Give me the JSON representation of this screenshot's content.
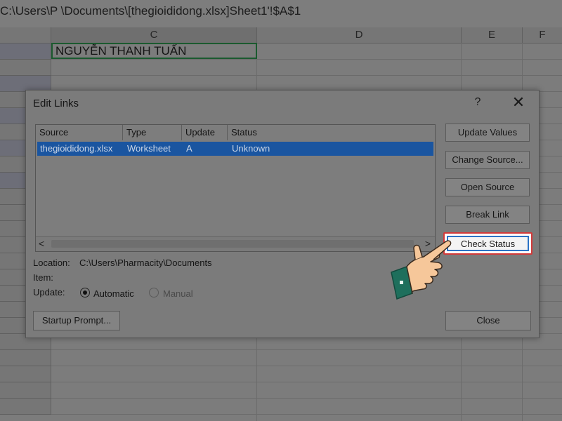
{
  "formula_bar": {
    "text": "C:\\Users\\P           \\Documents\\[thegioididong.xlsx]Sheet1'!$A$1"
  },
  "sheet": {
    "columns": [
      {
        "label": "C",
        "selected": true
      },
      {
        "label": "D",
        "selected": false
      },
      {
        "label": "E",
        "selected": false
      },
      {
        "label": "F",
        "selected": false
      }
    ],
    "active_cell_value": "NGUYỄN THANH TUẤN"
  },
  "dialog": {
    "title": "Edit Links",
    "help": "?",
    "close": "✕",
    "list": {
      "headers": [
        "Source",
        "Type",
        "Update",
        "Status"
      ],
      "rows": [
        {
          "source": "thegioididong.xlsx",
          "type": "Worksheet",
          "update": "A",
          "status": "Unknown"
        }
      ],
      "scroll_left": "<",
      "scroll_right": ">"
    },
    "location_label": "Location:",
    "location_value": "C:\\Users\\Pharmacity\\Documents",
    "item_label": "Item:",
    "update_label": "Update:",
    "automatic_label": "Automatic",
    "manual_label": "Manual",
    "update_mode": "Automatic",
    "buttons": {
      "update_values": "Update Values",
      "change_source": "Change Source...",
      "open_source": "Open Source",
      "break_link": "Break Link",
      "check_status": "Check Status",
      "startup_prompt": "Startup Prompt...",
      "close": "Close"
    }
  },
  "colors": {
    "highlight_border": "#d23a3a",
    "selection": "#1a55a0",
    "skin": "#f6c79a",
    "cuff": "#1e6f5c"
  },
  "icons": [
    "pointing-hand-icon",
    "help-icon",
    "close-icon",
    "radio-selected-icon",
    "radio-unselected-icon"
  ]
}
